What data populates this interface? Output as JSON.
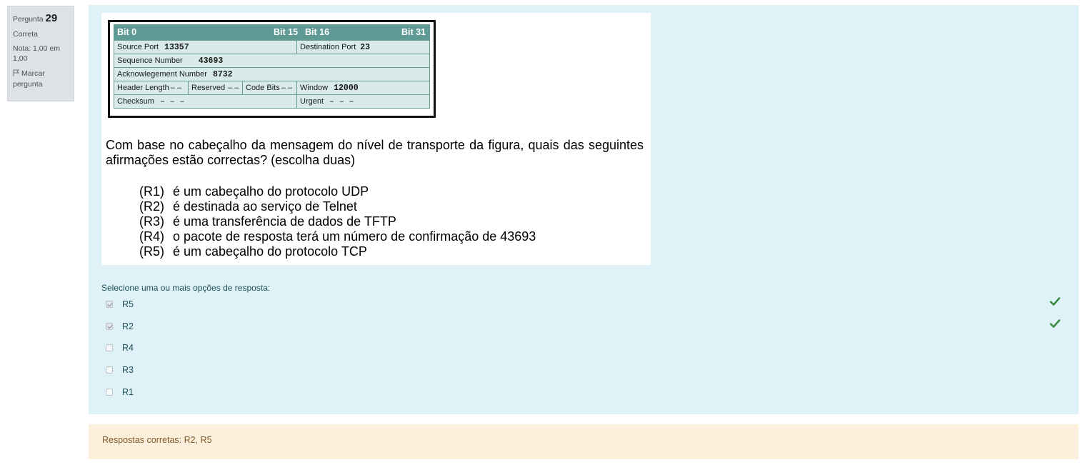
{
  "question_info": {
    "label": "Pergunta",
    "number": "29",
    "status": "Correta",
    "grade": "Nota: 1,00 em 1,00",
    "flag_label": "Marcar pergunta",
    "flag_icon": "flag-icon"
  },
  "figure": {
    "header": {
      "bit0": "Bit 0",
      "bit15": "Bit 15",
      "bit16": "Bit 16",
      "bit31": "Bit 31"
    },
    "fields": {
      "source_port_label": "Source Port",
      "source_port_value": "13357",
      "destination_port_label": "Destination Port",
      "destination_port_value": "23",
      "sequence_number_label": "Sequence Number",
      "sequence_number_value": "43693",
      "ack_number_label": "Acknowlegement Number",
      "ack_number_value": "8732",
      "header_length_label": "Header Length",
      "header_length_value": "– –",
      "reserved_label": "Reserved",
      "reserved_value": "– –",
      "code_bits_label": "Code Bits",
      "code_bits_value": "– –",
      "window_label": "Window",
      "window_value": "12000",
      "checksum_label": "Checksum",
      "checksum_value": "– – –",
      "urgent_label": "Urgent",
      "urgent_value": "– – –"
    },
    "stem": "Com base no cabeçalho da mensagem do nível de transporte da figura, quais das seguintes afirmações estão correctas? (escolha duas)",
    "statements": [
      {
        "code": "(R1)",
        "text": "é um cabeçalho do protocolo UDP"
      },
      {
        "code": "(R2)",
        "text": "é destinada ao serviço de Telnet"
      },
      {
        "code": "(R3)",
        "text": "é uma transferência de dados de TFTP"
      },
      {
        "code": "(R4)",
        "text": "o pacote de resposta terá um número de confirmação de 43693"
      },
      {
        "code": "(R5)",
        "text": "é um cabeçalho do protocolo TCP"
      }
    ]
  },
  "prompt": "Selecione uma ou mais opções de resposta:",
  "answers": [
    {
      "label": "R5",
      "checked": true,
      "correct": true
    },
    {
      "label": "R2",
      "checked": true,
      "correct": true
    },
    {
      "label": "R4",
      "checked": false,
      "correct": false
    },
    {
      "label": "R3",
      "checked": false,
      "correct": false
    },
    {
      "label": "R1",
      "checked": false,
      "correct": false
    }
  ],
  "feedback": "Respostas corretas: R2, R5",
  "colors": {
    "content_bg": "#def2f8",
    "feedback_bg": "#fcefdc",
    "tick": "#3e8a42",
    "header_teal": "#5f9b94"
  }
}
